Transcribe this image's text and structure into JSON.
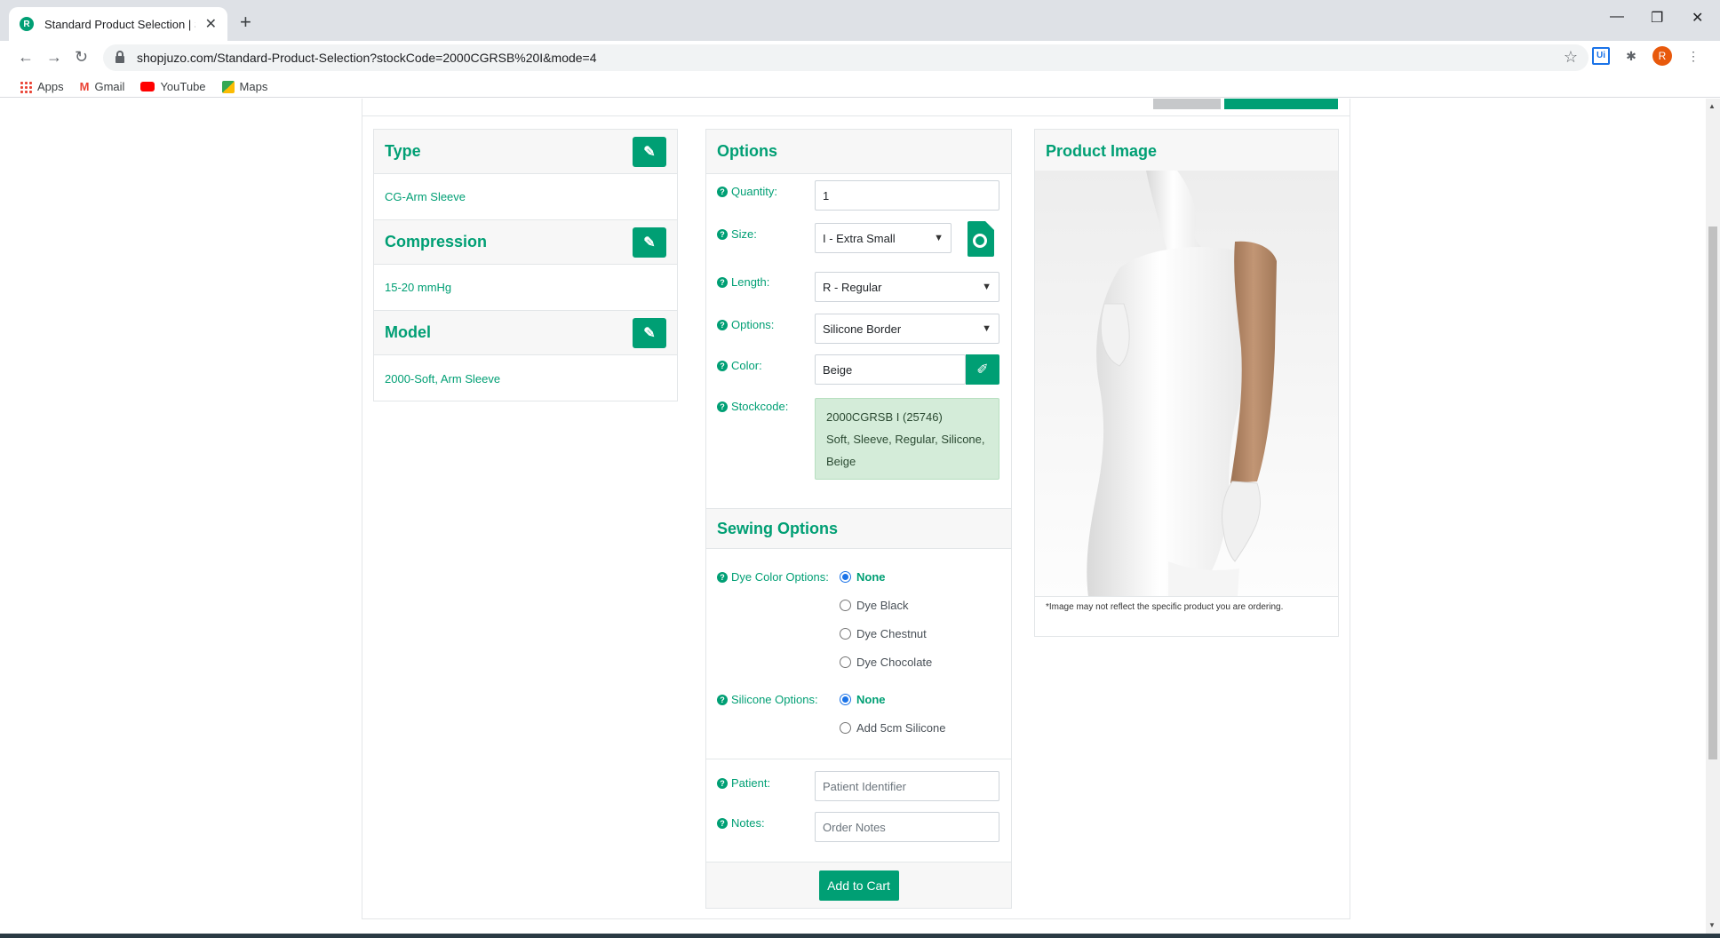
{
  "browser": {
    "tab_title": "Standard Product Selection | Sho",
    "favicon_letter": "R",
    "url": "shopjuzo.com/Standard-Product-Selection?stockCode=2000CGRSB%20I&mode=4",
    "profile_initial": "R",
    "ext_ui_label": "Ui",
    "bookmarks": [
      "Apps",
      "Gmail",
      "YouTube",
      "Maps"
    ]
  },
  "left_panels": {
    "type": {
      "title": "Type",
      "value": "CG-Arm Sleeve"
    },
    "compression": {
      "title": "Compression",
      "value": "15-20 mmHg"
    },
    "model": {
      "title": "Model",
      "value": "2000-Soft, Arm Sleeve"
    }
  },
  "options": {
    "title": "Options",
    "quantity_label": "Quantity:",
    "quantity_value": "1",
    "size_label": "Size:",
    "size_value": "I - Extra Small",
    "length_label": "Length:",
    "length_value": "R - Regular",
    "options_label": "Options:",
    "options_value": "Silicone Border",
    "color_label": "Color:",
    "color_value": "Beige",
    "stockcode_label": "Stockcode:",
    "stockcode_line1": "2000CGRSB I (25746)",
    "stockcode_line2": "Soft, Sleeve, Regular, Silicone,",
    "stockcode_line3": "Beige"
  },
  "sewing": {
    "title": "Sewing Options",
    "dye_label": "Dye Color Options:",
    "dye_options": [
      "None",
      "Dye Black",
      "Dye Chestnut",
      "Dye Chocolate"
    ],
    "silicone_label": "Silicone Options:",
    "silicone_options": [
      "None",
      "Add 5cm Silicone"
    ]
  },
  "order": {
    "patient_label": "Patient:",
    "patient_placeholder": "Patient Identifier",
    "notes_label": "Notes:",
    "notes_placeholder": "Order Notes",
    "add_to_cart": "Add to Cart"
  },
  "product_image": {
    "title": "Product Image",
    "note": "*Image may not reflect the specific product you are ordering."
  },
  "colors": {
    "accent": "#009f74",
    "stock_bg": "#d4ecd9",
    "sleeve": "#b58a68"
  }
}
